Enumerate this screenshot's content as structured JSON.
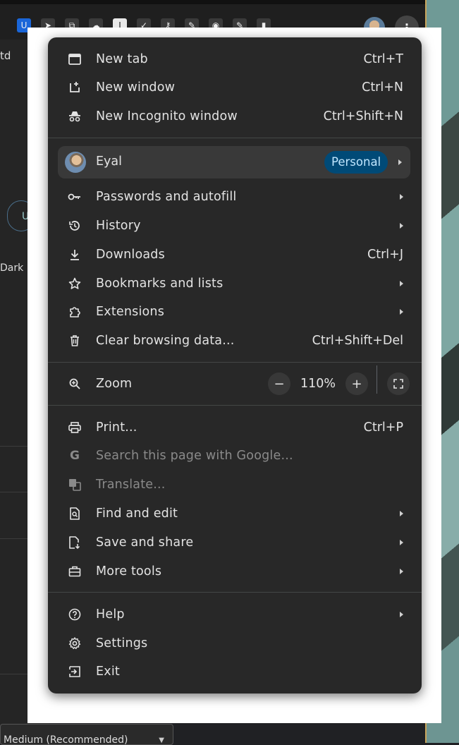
{
  "toolbar": {
    "extensions": [
      "bitwarden-icon",
      "send-icon",
      "copy-icon",
      "cloud-icon",
      "instapaper-icon",
      "check-icon",
      "key-icon",
      "pen-icon",
      "owl-icon",
      "extensions-puzzle-icon",
      "sidepanel-icon"
    ],
    "ext_labels": {
      "bitwarden": "U",
      "instapaper": "I"
    }
  },
  "background": {
    "partial_text_top": "td",
    "partial_pill": "U",
    "partial_dark": "Dark",
    "select_value": "Medium (Recommended)"
  },
  "menu": {
    "new_tab": {
      "label": "New tab",
      "shortcut": "Ctrl+T"
    },
    "new_window": {
      "label": "New window",
      "shortcut": "Ctrl+N"
    },
    "new_incognito": {
      "label": "New Incognito window",
      "shortcut": "Ctrl+Shift+N"
    },
    "profile": {
      "name": "Eyal",
      "badge": "Personal"
    },
    "passwords": {
      "label": "Passwords and autofill"
    },
    "history": {
      "label": "History"
    },
    "downloads": {
      "label": "Downloads",
      "shortcut": "Ctrl+J"
    },
    "bookmarks": {
      "label": "Bookmarks and lists"
    },
    "extensions": {
      "label": "Extensions"
    },
    "clear_data": {
      "label": "Clear browsing data...",
      "shortcut": "Ctrl+Shift+Del"
    },
    "zoom": {
      "label": "Zoom",
      "minus": "−",
      "value": "110%",
      "plus": "+"
    },
    "print": {
      "label": "Print...",
      "shortcut": "Ctrl+P"
    },
    "search_google": {
      "label": "Search this page with Google..."
    },
    "translate": {
      "label": "Translate..."
    },
    "find_edit": {
      "label": "Find and edit"
    },
    "save_share": {
      "label": "Save and share"
    },
    "more_tools": {
      "label": "More tools"
    },
    "help": {
      "label": "Help"
    },
    "settings": {
      "label": "Settings"
    },
    "exit": {
      "label": "Exit"
    }
  },
  "colors": {
    "menu_bg": "#282828",
    "profile_badge_bg": "#004a77",
    "profile_badge_text": "#c2e7ff",
    "disabled_text": "#8a8a8a"
  }
}
